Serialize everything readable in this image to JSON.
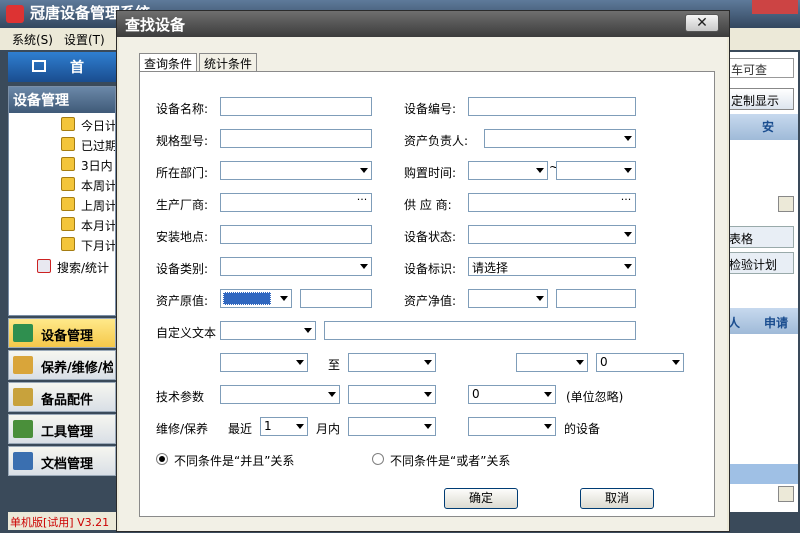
{
  "app": {
    "title": "冠唐设备管理系统",
    "menu": [
      "系统(S)",
      "设置(T)"
    ],
    "home_label": "首",
    "left_panel_title": "设备管理",
    "tree_items": [
      "今日计",
      "已过期",
      "3日内",
      "本周计",
      "上周计",
      "本月计",
      "下月计"
    ],
    "search_item": "搜索/统计",
    "nav": [
      "设备管理",
      "保养/维修/检",
      "备品配件",
      "工具管理",
      "文档管理"
    ],
    "status": "单机版[试用]  V3.21",
    "right_search": "车可查",
    "right_display": "定制显示",
    "right_col1": "安",
    "right_table_btn": "表格",
    "right_plan_btn": "检验计划",
    "right_col2a": "人",
    "right_col2b": "申请"
  },
  "dialog": {
    "title": "查找设备",
    "close_label": "✕",
    "tabs": [
      "查询条件",
      "统计条件"
    ],
    "labels": {
      "device_name": "设备名称:",
      "device_code": "设备编号:",
      "spec": "规格型号:",
      "owner": "资产负责人:",
      "department": "所在部门:",
      "purchase_time": "购置时间:",
      "manufacturer": "生产厂商:",
      "supplier": "供 应 商:",
      "location": "安装地点:",
      "device_status": "设备状态:",
      "device_type": "设备类别:",
      "device_flag": "设备标识:",
      "original_value": "资产原值:",
      "net_value": "资产净值:",
      "custom_text": "自定义文本",
      "to": "至",
      "tech_params": "技术参数",
      "unit_ignore": "(单位忽略)",
      "maintenance": "维修/保养",
      "recent": "最近",
      "within_month": "月内",
      "of_device": "的设备",
      "tilde": "~"
    },
    "values": {
      "device_flag": "请选择",
      "range_right": "0",
      "tech_value": "0",
      "recent_months": "1"
    },
    "radios": [
      "不同条件是“并且”关系",
      "不同条件是“或者”关系"
    ],
    "ok_label": "确定",
    "cancel_label": "取消",
    "ellipsis": "···"
  }
}
